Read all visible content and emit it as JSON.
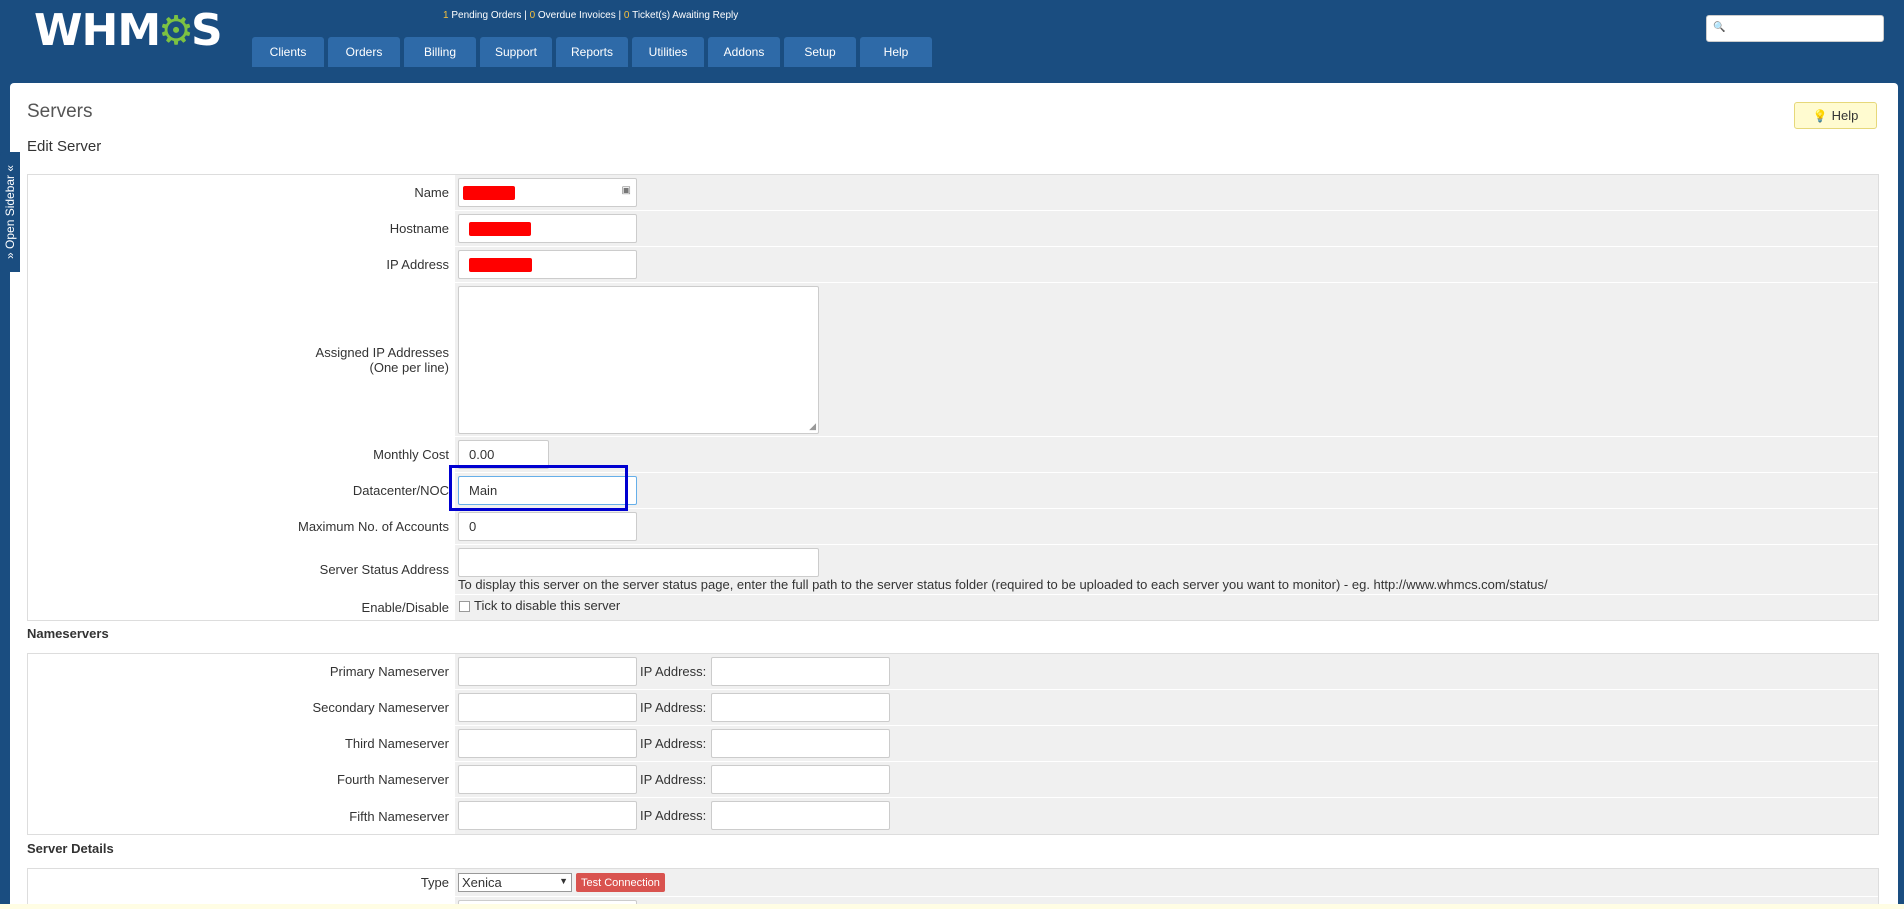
{
  "header": {
    "logo_text_a": "WHM",
    "logo_text_b": "S",
    "notifications": {
      "pending_orders_count": "1",
      "pending_orders_label": "Pending Orders",
      "overdue_invoices_count": "0",
      "overdue_invoices_label": "Overdue Invoices",
      "tickets_count": "0",
      "tickets_label": "Ticket(s) Awaiting Reply",
      "separator": "|"
    },
    "nav_tabs": [
      "Clients",
      "Orders",
      "Billing",
      "Support",
      "Reports",
      "Utilities",
      "Addons",
      "Setup",
      "Help"
    ],
    "search_placeholder": ""
  },
  "page": {
    "title": "Servers",
    "subtitle": "Edit Server",
    "help_label": "Help",
    "open_sidebar_label": "» Open Sidebar «"
  },
  "edit_server": {
    "name_label": "Name",
    "hostname_label": "Hostname",
    "ip_address_label": "IP Address",
    "assigned_ips_label_line1": "Assigned IP Addresses",
    "assigned_ips_label_line2": "(One per line)",
    "monthly_cost_label": "Monthly Cost",
    "monthly_cost_value": "0.00",
    "datacenter_label": "Datacenter/NOC",
    "datacenter_value": "Main",
    "max_accounts_label": "Maximum No. of Accounts",
    "max_accounts_value": "0",
    "status_address_label": "Server Status Address",
    "status_address_help": "To display this server on the server status page, enter the full path to the server status folder (required to be uploaded to each server you want to monitor) - eg. http://www.whmcs.com/status/",
    "enable_label": "Enable/Disable",
    "disable_checkbox_label": "Tick to disable this server"
  },
  "nameservers": {
    "section_title": "Nameservers",
    "ip_label": "IP Address:",
    "rows": [
      "Primary Nameserver",
      "Secondary Nameserver",
      "Third Nameserver",
      "Fourth Nameserver",
      "Fifth Nameserver"
    ]
  },
  "server_details": {
    "section_title": "Server Details",
    "type_label": "Type",
    "type_value": "Xenica",
    "test_connection_label": "Test Connection"
  },
  "colors": {
    "header_bg": "#1a4d80",
    "nav_tab_bg": "#2e6aa8",
    "accent_yellow": "#f7c13c",
    "logo_green": "#7cc242",
    "highlight_box": "#0000d0",
    "test_button": "#d9534f"
  }
}
